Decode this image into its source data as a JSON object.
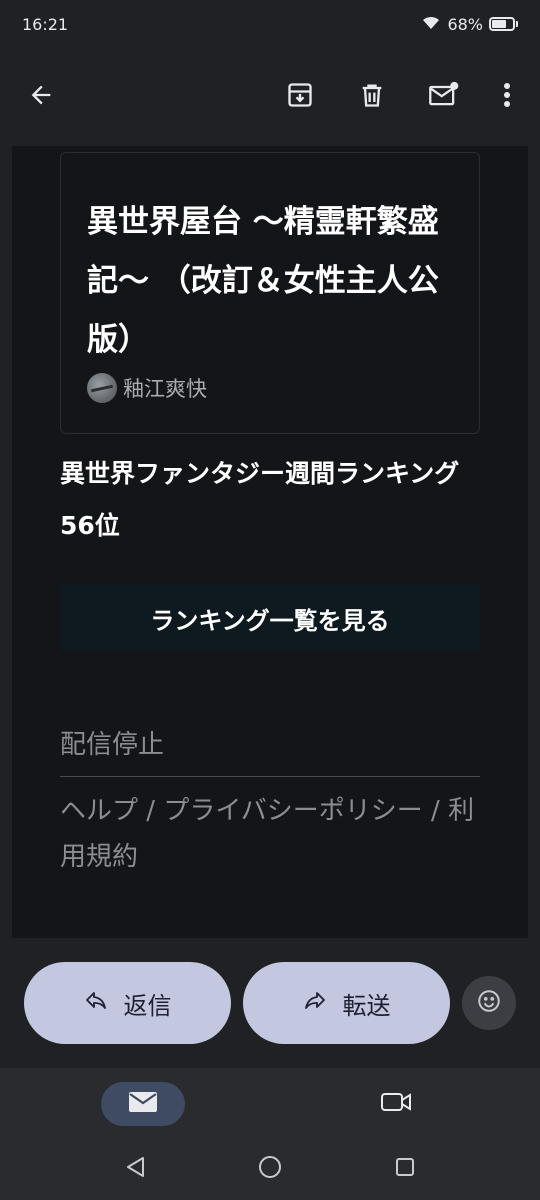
{
  "status_bar": {
    "time": "16:21",
    "battery": "68%",
    "battery_level": 0.68
  },
  "app_bar": {
    "back_icon": "arrow-left-icon",
    "archive_icon": "archive-icon",
    "delete_icon": "trash-icon",
    "mark_unread_icon": "mail-unread-icon",
    "more_icon": "more-vert-icon"
  },
  "email": {
    "book_title": "異世界屋台 〜精霊軒繁盛記〜 （改訂＆女性主人公版）",
    "author": "釉江爽快",
    "ranking_text": "異世界ファンタジー週間ランキング 56位",
    "ranking_button": "ランキング一覧を見る",
    "unsubscribe": "配信停止",
    "footer": {
      "help": "ヘルプ",
      "privacy": "プライバシーポリシー",
      "terms": "利用規約",
      "separator": " / "
    }
  },
  "actions": {
    "reply_label": "返信",
    "forward_label": "転送",
    "reply_icon": "reply-icon",
    "forward_icon": "forward-icon",
    "emoji_icon": "emoji-icon"
  },
  "bottom_nav": {
    "mail_icon": "mail-icon",
    "meet_icon": "video-camera-icon"
  },
  "colors": {
    "pill": "#c3c7e0",
    "background": "#202124",
    "email_bg": "#141518",
    "nav_active": "#3f4a63"
  }
}
